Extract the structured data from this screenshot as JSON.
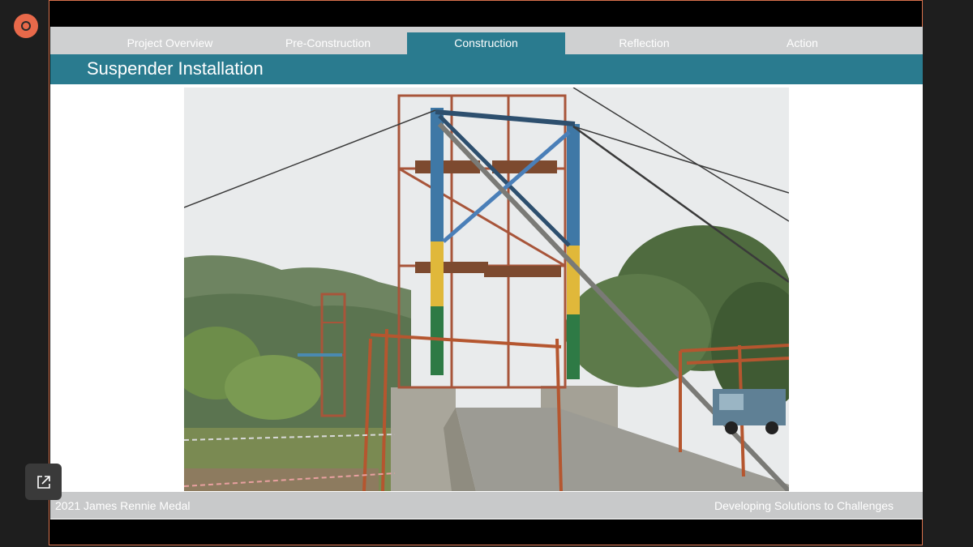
{
  "meeting": {
    "record_icon": "record-icon",
    "popout_icon": "external-link-icon"
  },
  "slide": {
    "nav": {
      "tabs": [
        {
          "label": "Project Overview",
          "active": false
        },
        {
          "label": "Pre-Construction",
          "active": false
        },
        {
          "label": "Construction",
          "active": true
        },
        {
          "label": "Reflection",
          "active": false
        },
        {
          "label": "Action",
          "active": false
        }
      ]
    },
    "title": "Suspender Installation",
    "photo_description_icon": "bridge-photo",
    "footer": {
      "left": "2021 James Rennie Medal",
      "right": "Developing Solutions to Challenges"
    }
  },
  "colors": {
    "accent": "#2a7b8f",
    "nav_bg": "#cfd0d1",
    "footer_bg": "#c8c9ca",
    "record": "#e8694a",
    "frame_border": "#d9714c"
  }
}
